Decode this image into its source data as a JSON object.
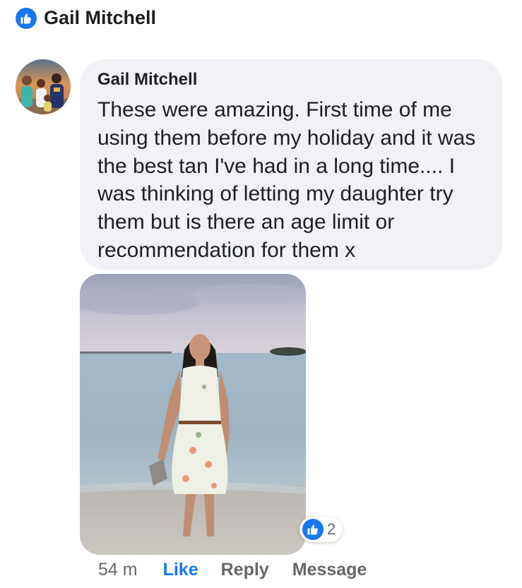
{
  "colors": {
    "accent": "#1877f2",
    "bubble_bg": "#f0f2f5",
    "meta_text": "#65676b"
  },
  "header": {
    "icon": "like-badge-icon",
    "name": "Gail Mitchell"
  },
  "comment": {
    "avatar_icon": "profile-photo",
    "author": "Gail Mitchell",
    "text": "These were amazing.  First time of me using them before my holiday and it was the best tan I've had in a long time.... I was thinking of letting my daughter try them but is there an age limit or recommendation for them x",
    "attachment": "photo-woman-on-beach",
    "reactions": {
      "icon": "like-icon",
      "count": "2"
    },
    "actions": {
      "time": "54 m",
      "like": "Like",
      "reply": "Reply",
      "message": "Message"
    }
  }
}
